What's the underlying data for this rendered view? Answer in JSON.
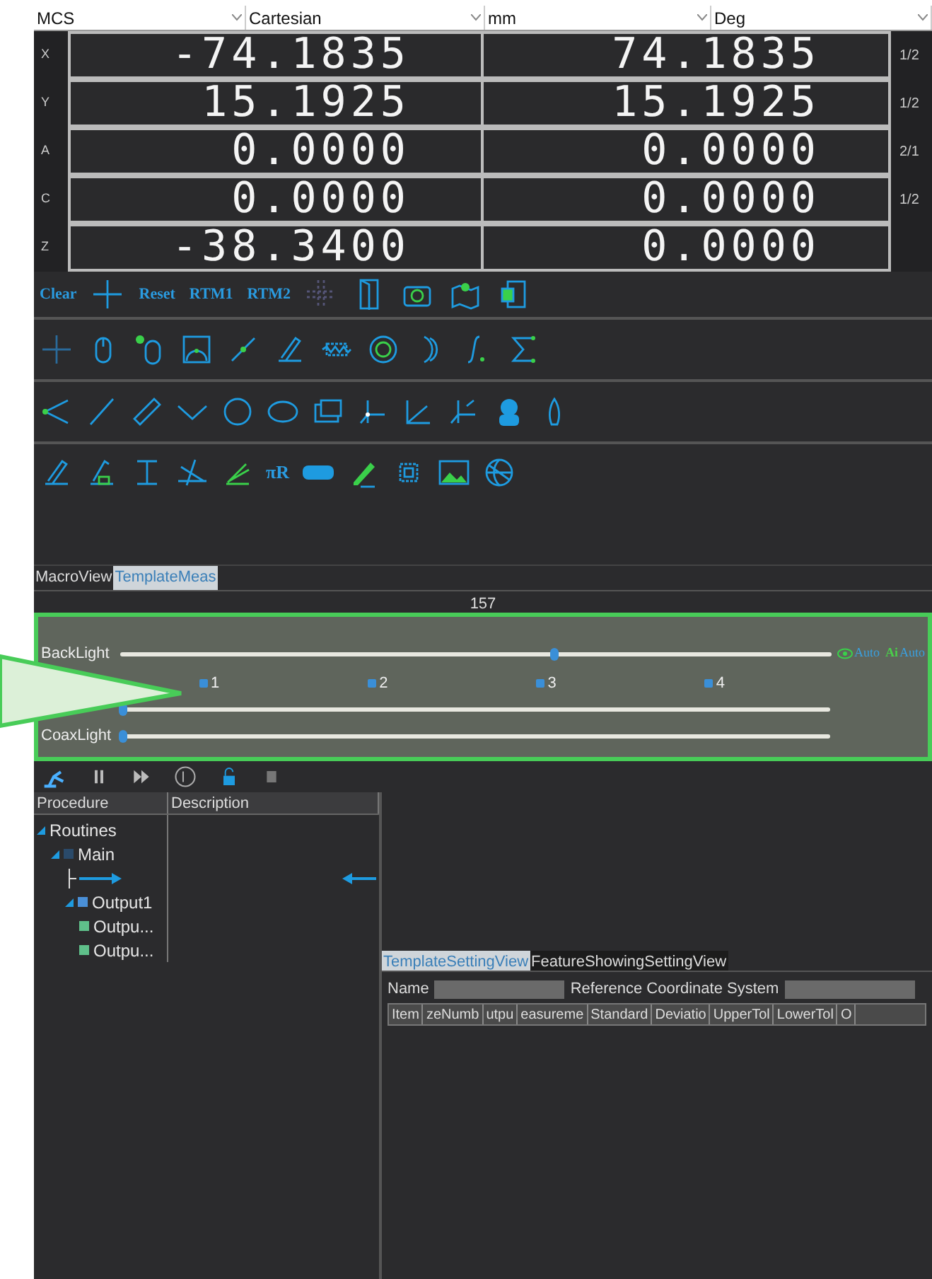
{
  "header": {
    "frame": "MCS",
    "system": "Cartesian",
    "unit": "mm",
    "angle": "Deg"
  },
  "axes": [
    {
      "axis": "X",
      "machine": "-74.1835",
      "work": "74.1835",
      "ratio": "1/2"
    },
    {
      "axis": "Y",
      "machine": "15.1925",
      "work": "15.1925",
      "ratio": "1/2"
    },
    {
      "axis": "A",
      "machine": "0.0000",
      "work": "0.0000",
      "ratio": "2/1"
    },
    {
      "axis": "C",
      "machine": "0.0000",
      "work": "0.0000",
      "ratio": "1/2"
    },
    {
      "axis": "Z",
      "machine": "-38.3400",
      "work": "0.0000"
    }
  ],
  "toolbar": {
    "text_buttons": [
      "Clear",
      "Reset",
      "RTM1",
      "RTM2"
    ],
    "radius_button": "πR"
  },
  "tabs": [
    {
      "label": "MacroView",
      "selected": false
    },
    {
      "label": "TemplateMeas",
      "selected": true
    }
  ],
  "lights": {
    "value_tip": "157",
    "backlight": {
      "label": "BackLight",
      "level": 0.61
    },
    "eye_auto": "Auto",
    "ai_badge": "Ai",
    "ai_auto": "Auto",
    "channels": [
      {
        "label": "1",
        "checked": true
      },
      {
        "label": "2",
        "checked": true
      },
      {
        "label": "3",
        "checked": true
      },
      {
        "label": "4",
        "checked": true
      }
    ],
    "ring": {
      "level": 0
    },
    "coax": {
      "label": "CoaxLight",
      "level": 0
    }
  },
  "procedure": {
    "columns": [
      "Procedure",
      "Description"
    ],
    "tree": [
      {
        "label": "Routines",
        "expanded": true,
        "children": [
          {
            "label": "Main",
            "expanded": true,
            "children": [
              {
                "kind": "step"
              },
              {
                "label": "Output1",
                "expanded": true,
                "children": [
                  {
                    "label": "Outpu..."
                  },
                  {
                    "label": "Outpu..."
                  }
                ]
              }
            ]
          }
        ]
      }
    ]
  },
  "bottom_tabs": [
    {
      "label": "TemplateSettingView",
      "selected": true
    },
    {
      "label": "FeatureShowingSettingView",
      "selected": false
    }
  ],
  "fields": [
    {
      "label": "Name"
    },
    {
      "label": "Reference Coordinate System"
    }
  ],
  "table": {
    "columns": [
      "Item",
      "zeNumb",
      "utpu",
      "easureme",
      "Standard",
      "Deviatio",
      "UpperTol",
      "LowerTol",
      "O"
    ]
  }
}
